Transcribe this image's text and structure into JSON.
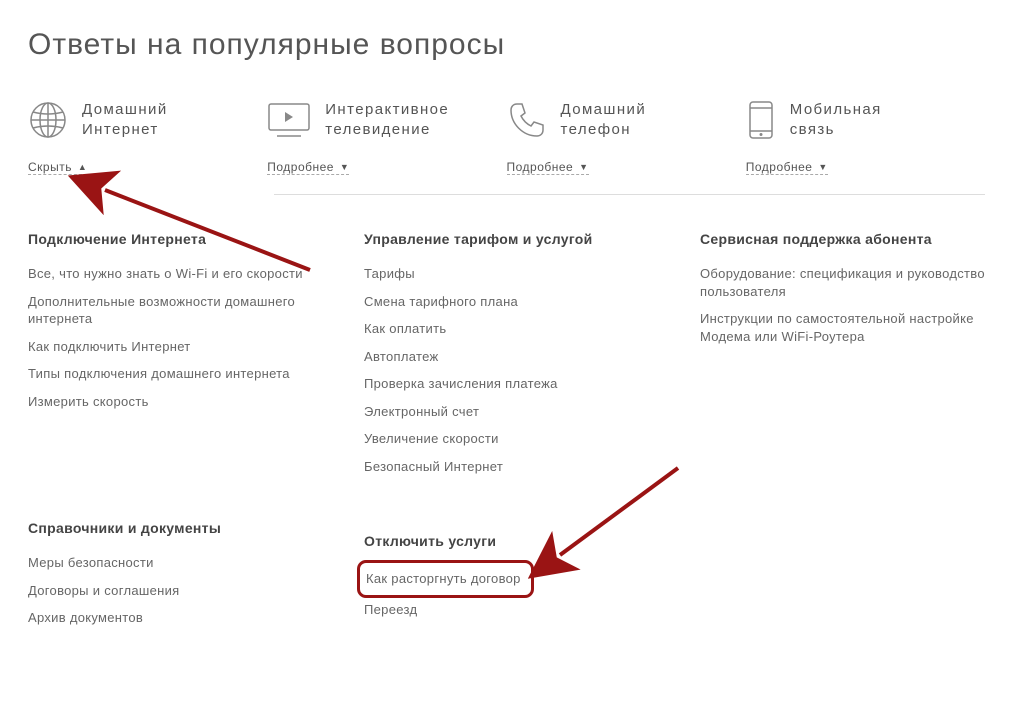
{
  "page_title": "Ответы на популярные вопросы",
  "categories": [
    {
      "title_l1": "Домашний",
      "title_l2": "Интернет",
      "toggle": "Скрыть",
      "arrow": "▲"
    },
    {
      "title_l1": "Интерактивное",
      "title_l2": "телевидение",
      "toggle": "Подробнее",
      "arrow": "▼"
    },
    {
      "title_l1": "Домашний",
      "title_l2": "телефон",
      "toggle": "Подробнее",
      "arrow": "▼"
    },
    {
      "title_l1": "Мобильная",
      "title_l2": "связь",
      "toggle": "Подробнее",
      "arrow": "▼"
    }
  ],
  "col1": {
    "sec1": {
      "heading": "Подключение Интернета",
      "items": [
        "Все, что нужно знать о Wi-Fi и его скорости",
        "Дополнительные возможности домашнего интернета",
        "Как подключить Интернет",
        "Типы подключения домашнего интернета",
        "Измерить скорость"
      ]
    },
    "sec2": {
      "heading": "Справочники и документы",
      "items": [
        "Меры безопасности",
        "Договоры и соглашения",
        "Архив документов"
      ]
    }
  },
  "col2": {
    "sec1": {
      "heading": "Управление тарифом и услугой",
      "items": [
        "Тарифы",
        "Смена тарифного плана",
        "Как оплатить",
        "Автоплатеж",
        "Проверка зачисления платежа",
        "Электронный счет",
        "Увеличение скорости",
        "Безопасный Интернет"
      ]
    },
    "sec2": {
      "heading": "Отключить услуги",
      "items": [
        "Как расторгнуть договор",
        "Переезд"
      ]
    }
  },
  "col3": {
    "sec1": {
      "heading": "Сервисная поддержка абонента",
      "items": [
        "Оборудование: спецификация и руководство пользователя",
        "Инструкции по самостоятельной настройке Модема или WiFi-Роутера"
      ]
    }
  }
}
